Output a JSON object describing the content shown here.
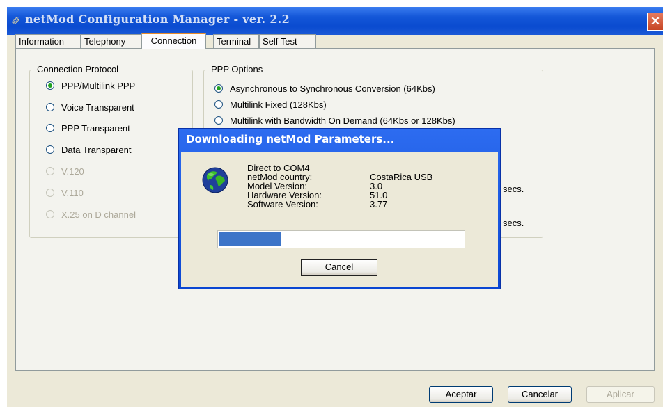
{
  "window": {
    "title": "netMod Configuration Manager  -  ver. 2.2",
    "close_glyph": "✕"
  },
  "tabs": [
    "Information",
    "Telephony",
    "Connection",
    "Terminal",
    "Self Test"
  ],
  "active_tab": "Connection",
  "connection_protocol": {
    "label": "Connection Protocol",
    "options": [
      {
        "label": "PPP/Multilink PPP",
        "selected": true,
        "enabled": true
      },
      {
        "label": "Voice Transparent",
        "selected": false,
        "enabled": true
      },
      {
        "label": "PPP Transparent",
        "selected": false,
        "enabled": true
      },
      {
        "label": "Data Transparent",
        "selected": false,
        "enabled": true
      },
      {
        "label": "V.120",
        "selected": false,
        "enabled": false
      },
      {
        "label": "V.110",
        "selected": false,
        "enabled": false
      },
      {
        "label": "X.25 on D channel",
        "selected": false,
        "enabled": false
      }
    ]
  },
  "ppp_options": {
    "label": "PPP Options",
    "options": [
      {
        "label": "Asynchronous to Synchronous Conversion (64Kbs)",
        "selected": true
      },
      {
        "label": "Multilink Fixed (128Kbs)",
        "selected": false
      },
      {
        "label": "Multilink with Bandwidth On Demand (64Kbs or 128Kbs)",
        "selected": false
      }
    ],
    "secs_labels": [
      "secs.",
      "secs."
    ]
  },
  "footer": {
    "ok_label": "Aceptar",
    "cancel_label": "Cancelar",
    "apply_label": "Aplicar"
  },
  "dialog": {
    "title": "Downloading netMod Parameters...",
    "icon": "globe-icon",
    "connection_line": "Direct to COM4",
    "rows": [
      {
        "label": "netMod country:",
        "value": "CostaRica USB"
      },
      {
        "label": "Model Version:",
        "value": "3.0"
      },
      {
        "label": "Hardware Version:",
        "value": "51.0"
      },
      {
        "label": "Software Version:",
        "value": "3.77"
      }
    ],
    "progress_fraction": 0.25,
    "cancel_label": "Cancel"
  },
  "colors": {
    "titlebar": "#0a4bd0",
    "progress": "#3c74c8",
    "accent_tab": "#e68b2c"
  }
}
